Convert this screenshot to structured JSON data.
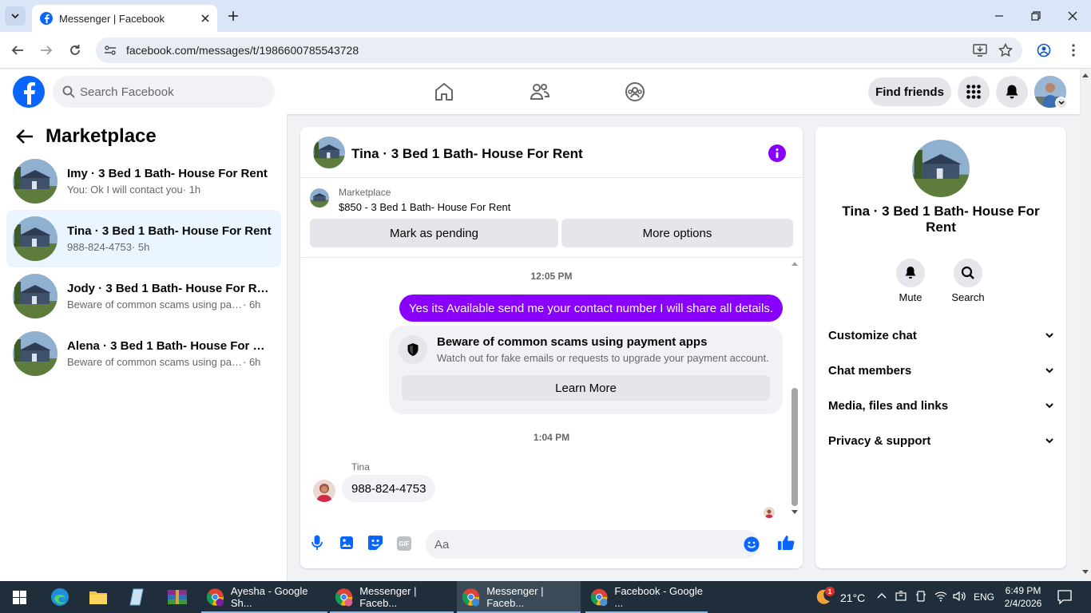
{
  "browser": {
    "tab_title": "Messenger | Facebook",
    "url": "facebook.com/messages/t/1986600785543728"
  },
  "header": {
    "search_placeholder": "Search Facebook",
    "find_friends": "Find friends"
  },
  "sidebar": {
    "title": "Marketplace",
    "conversations": [
      {
        "name": "Imy · 3 Bed 1 Bath- House For Rent",
        "preview": "You: Ok I will contact you",
        "time": "· 1h",
        "active": false
      },
      {
        "name": "Tina · 3 Bed 1 Bath- House For Rent",
        "preview": "988-824-4753",
        "time": "· 5h",
        "active": true
      },
      {
        "name": "Jody · 3 Bed 1 Bath- House For Rent",
        "preview": "Beware of common scams using pay...",
        "time": "· 6h",
        "active": false
      },
      {
        "name": "Alena · 3 Bed 1 Bath- House For Re...",
        "preview": "Beware of common scams using pay...",
        "time": "· 6h",
        "active": false
      }
    ]
  },
  "chat": {
    "title": "Tina · 3 Bed 1 Bath- House For Rent",
    "listing_label": "Marketplace",
    "listing_title": "$850 - 3 Bed 1 Bath- House For Rent",
    "mark_pending": "Mark as pending",
    "more_options": "More options",
    "time1": "12:05 PM",
    "outgoing_message": "Yes its Available send me your contact number I will share all details.",
    "scam_title": "Beware of common scams using payment apps",
    "scam_body": "Watch out for fake emails or requests to upgrade your payment account.",
    "learn_more": "Learn More",
    "time2": "1:04 PM",
    "sender_name": "Tina",
    "incoming_message": "988-824-4753",
    "composer_placeholder": "Aa"
  },
  "details": {
    "title": "Tina · 3 Bed 1 Bath- House For Rent",
    "mute": "Mute",
    "search": "Search",
    "sections": [
      "Customize chat",
      "Chat members",
      "Media, files and links",
      "Privacy & support"
    ]
  },
  "taskbar": {
    "apps": [
      "Ayesha - Google Sh...",
      "Messenger | Faceb...",
      "Messenger | Faceb...",
      "Facebook - Google ..."
    ],
    "weather_badge": "1",
    "temperature": "21°C",
    "language": "ENG",
    "time": "6:49 PM",
    "date": "2/4/2026"
  },
  "colors": {
    "fb_blue": "#0866ff",
    "messenger_purple": "#8a00ff",
    "taskbar": "#1f2e3a"
  }
}
